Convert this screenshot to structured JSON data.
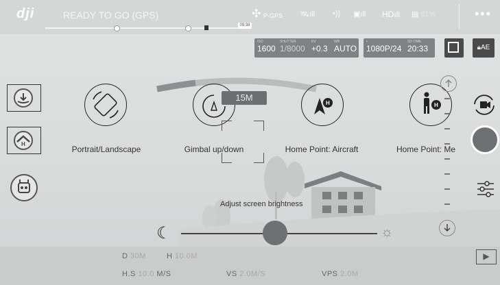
{
  "topbar": {
    "logo": "dji",
    "status": "READY TO GO (GPS)",
    "flight_time_chip": "09:38",
    "mode": "P-GPS",
    "hd_label": "HD",
    "battery": "61%",
    "menu": "•••"
  },
  "camera": {
    "iso_label": "ISO",
    "iso": "1600",
    "shutter_label": "SHUTTER",
    "shutter": "1/8000",
    "ev_label": "EV",
    "ev": "+0.3",
    "wb_label": "WB",
    "wb": "AUTO",
    "video_res": "1080P/24",
    "sd_label": "SD TIME",
    "sd_time": "20:33",
    "ae_label": "AE"
  },
  "hints": [
    {
      "label": "Portrait/Landscape"
    },
    {
      "label": "Gimbal up/down"
    },
    {
      "label": "Home Point: Aircraft"
    },
    {
      "label": "Home Point: Me"
    }
  ],
  "zoom": "15M",
  "brightness": {
    "label": "Adjust screen brightness",
    "level": 0.48
  },
  "telemetry": {
    "d_key": "D",
    "d_val": "30M",
    "h_key": "H",
    "h_val": "10.0M",
    "hs_key": "H.S",
    "hs_val": "10.0",
    "hs_unit": "M/S",
    "vs_key": "VS",
    "vs_val": "2.0M/S",
    "vps_key": "VPS",
    "vps_val": "2.0M"
  }
}
